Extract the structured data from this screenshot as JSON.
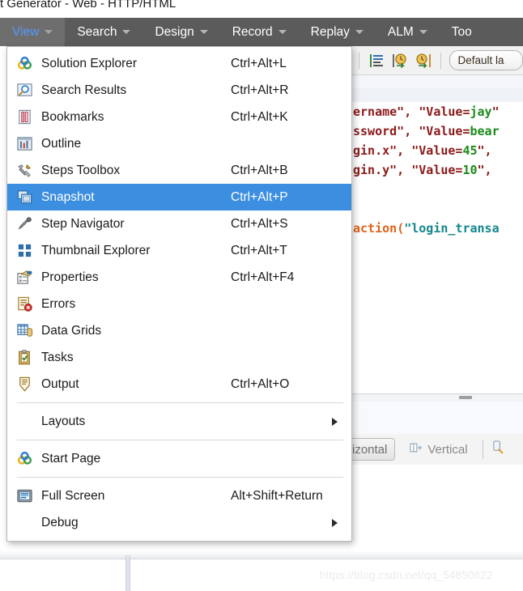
{
  "window": {
    "title": "t Generator - Web - HTTP/HTML"
  },
  "menubar": {
    "items": [
      {
        "label": "View",
        "active": true
      },
      {
        "label": "Search",
        "active": false
      },
      {
        "label": "Design",
        "active": false
      },
      {
        "label": "Record",
        "active": false
      },
      {
        "label": "Replay",
        "active": false
      },
      {
        "label": "ALM",
        "active": false
      },
      {
        "label": "Too",
        "active": false
      }
    ]
  },
  "view_menu": {
    "items": [
      {
        "kind": "item",
        "icon": "solution-explorer-icon",
        "label": "Solution Explorer",
        "accel": "Ctrl+Alt+L",
        "highlight": false,
        "submenu": false
      },
      {
        "kind": "item",
        "icon": "search-results-icon",
        "label": "Search Results",
        "accel": "Ctrl+Alt+R",
        "highlight": false,
        "submenu": false
      },
      {
        "kind": "item",
        "icon": "bookmarks-icon",
        "label": "Bookmarks",
        "accel": "Ctrl+Alt+K",
        "highlight": false,
        "submenu": false
      },
      {
        "kind": "item",
        "icon": "outline-icon",
        "label": "Outline",
        "accel": "",
        "highlight": false,
        "submenu": false
      },
      {
        "kind": "item",
        "icon": "steps-toolbox-icon",
        "label": "Steps Toolbox",
        "accel": "Ctrl+Alt+B",
        "highlight": false,
        "submenu": false
      },
      {
        "kind": "item",
        "icon": "snapshot-icon",
        "label": "Snapshot",
        "accel": "Ctrl+Alt+P",
        "highlight": true,
        "submenu": false
      },
      {
        "kind": "item",
        "icon": "step-navigator-icon",
        "label": "Step Navigator",
        "accel": "Ctrl+Alt+S",
        "highlight": false,
        "submenu": false
      },
      {
        "kind": "item",
        "icon": "thumbnail-explorer-icon",
        "label": "Thumbnail Explorer",
        "accel": "Ctrl+Alt+T",
        "highlight": false,
        "submenu": false
      },
      {
        "kind": "item",
        "icon": "properties-icon",
        "label": "Properties",
        "accel": "Ctrl+Alt+F4",
        "highlight": false,
        "submenu": false
      },
      {
        "kind": "item",
        "icon": "errors-icon",
        "label": "Errors",
        "accel": "",
        "highlight": false,
        "submenu": false
      },
      {
        "kind": "item",
        "icon": "data-grids-icon",
        "label": "Data Grids",
        "accel": "",
        "highlight": false,
        "submenu": false
      },
      {
        "kind": "item",
        "icon": "tasks-icon",
        "label": "Tasks",
        "accel": "",
        "highlight": false,
        "submenu": false
      },
      {
        "kind": "item",
        "icon": "output-icon",
        "label": "Output",
        "accel": "Ctrl+Alt+O",
        "highlight": false,
        "submenu": false
      },
      {
        "kind": "separator"
      },
      {
        "kind": "item",
        "icon": "",
        "label": "Layouts",
        "accel": "",
        "highlight": false,
        "submenu": true
      },
      {
        "kind": "separator"
      },
      {
        "kind": "item",
        "icon": "start-page-icon",
        "label": "Start Page",
        "accel": "",
        "highlight": false,
        "submenu": false
      },
      {
        "kind": "separator"
      },
      {
        "kind": "item",
        "icon": "full-screen-icon",
        "label": "Full Screen",
        "accel": "Alt+Shift+Return",
        "highlight": false,
        "submenu": false
      },
      {
        "kind": "item",
        "icon": "",
        "label": "Debug",
        "accel": "",
        "highlight": false,
        "submenu": true
      }
    ]
  },
  "toolbar": {
    "layout_combo_value": "Default la"
  },
  "editor": {
    "lines": [
      [
        {
          "t": "ername\", ",
          "c": "tok-str"
        },
        {
          "t": "\"Value=",
          "c": "tok-str"
        },
        {
          "t": "jay",
          "c": "tok-val"
        },
        {
          "t": "\"",
          "c": "tok-str"
        }
      ],
      [
        {
          "t": "ssword\", ",
          "c": "tok-str"
        },
        {
          "t": "\"Value=",
          "c": "tok-str"
        },
        {
          "t": "bear",
          "c": "tok-val"
        }
      ],
      [
        {
          "t": "gin.x\", ",
          "c": "tok-str"
        },
        {
          "t": "\"Value=",
          "c": "tok-str"
        },
        {
          "t": "45",
          "c": "tok-val"
        },
        {
          "t": "\",",
          "c": "tok-str"
        }
      ],
      [
        {
          "t": "gin.y\", ",
          "c": "tok-str"
        },
        {
          "t": "\"Value=",
          "c": "tok-str"
        },
        {
          "t": "10",
          "c": "tok-val"
        },
        {
          "t": "\",",
          "c": "tok-str"
        }
      ],
      [],
      [],
      [
        {
          "t": "action",
          "c": "tok-fn"
        },
        {
          "t": "(",
          "c": "tok-paren"
        },
        {
          "t": "\"login_transa",
          "c": "tok-teal"
        }
      ]
    ]
  },
  "view_tabs": {
    "items": [
      {
        "label": "rizontal",
        "selected": true,
        "icon": ""
      },
      {
        "label": "Vertical",
        "selected": false,
        "icon": "vertical-split-icon"
      }
    ]
  },
  "watermark": {
    "text": "https://blog.csdn.net/qq_54850622"
  }
}
